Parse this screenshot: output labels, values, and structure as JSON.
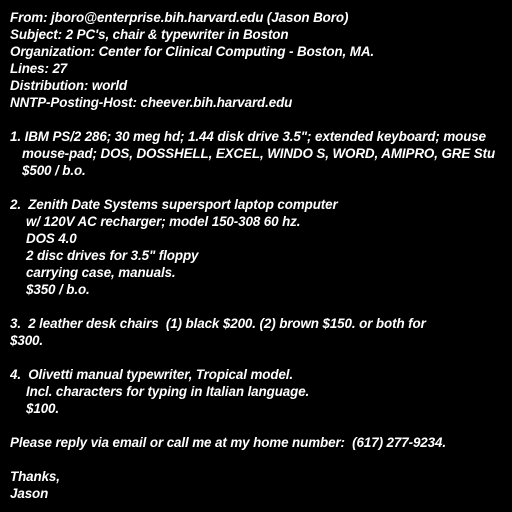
{
  "header": {
    "from": "From: jboro@enterprise.bih.harvard.edu (Jason Boro)",
    "subject": "Subject: 2 PC's, chair & typewriter in Boston",
    "organization": "Organization: Center for Clinical Computing - Boston, MA.",
    "lines": "Lines: 27",
    "distribution": "Distribution: world",
    "nntp_host": "NNTP-Posting-Host: cheever.bih.harvard.edu"
  },
  "body": {
    "item1": {
      "line1": "1. IBM PS/2 286; 30 meg hd; 1.44 disk drive 3.5\"; extended keyboard; mouse",
      "line2": "mouse-pad; DOS, DOSSHELL, EXCEL, WINDO S, WORD, AMIPRO, GRE Stu",
      "price": "$500 / b.o."
    },
    "item2": {
      "line1": "2.  Zenith Date Systems supersport laptop computer",
      "line2": "w/ 120V AC recharger; model 150-308 60 hz.",
      "line3": "DOS 4.0",
      "line4": "2 disc drives for 3.5\" floppy",
      "line5": "carrying case, manuals.",
      "price": "$350 / b.o."
    },
    "item3": {
      "line1": "3.  2 leather desk chairs  (1) black $200. (2) brown $150. or both for",
      "line2": "$300."
    },
    "item4": {
      "line1": "4.  Olivetti manual typewriter, Tropical model.",
      "line2": "Incl. characters for typing in Italian language.",
      "price": "$100."
    },
    "reply": "Please reply via email or call me at my home number:  (617) 277-9234.",
    "signoff": "Thanks,",
    "signature": "Jason"
  }
}
